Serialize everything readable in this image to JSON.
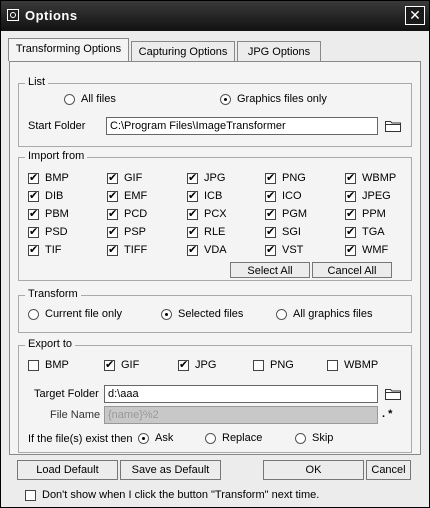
{
  "window": {
    "title": "Options",
    "close_symbol": "✕"
  },
  "tabs": [
    {
      "label": "Transforming Options",
      "active": true
    },
    {
      "label": "Capturing Options",
      "active": false
    },
    {
      "label": "JPG Options",
      "active": false
    }
  ],
  "list": {
    "legend": "List",
    "options": [
      {
        "label": "All files",
        "selected": false
      },
      {
        "label": "Graphics files only",
        "selected": true
      }
    ],
    "start_folder_label": "Start Folder",
    "start_folder_value": "C:\\Program Files\\ImageTransformer"
  },
  "import_from": {
    "legend": "Import from",
    "formats": [
      {
        "label": "BMP",
        "checked": true
      },
      {
        "label": "GIF",
        "checked": true
      },
      {
        "label": "JPG",
        "checked": true
      },
      {
        "label": "PNG",
        "checked": true
      },
      {
        "label": "WBMP",
        "checked": true
      },
      {
        "label": "DIB",
        "checked": true
      },
      {
        "label": "EMF",
        "checked": true
      },
      {
        "label": "ICB",
        "checked": true
      },
      {
        "label": "ICO",
        "checked": true
      },
      {
        "label": "JPEG",
        "checked": true
      },
      {
        "label": "PBM",
        "checked": true
      },
      {
        "label": "PCD",
        "checked": true
      },
      {
        "label": "PCX",
        "checked": true
      },
      {
        "label": "PGM",
        "checked": true
      },
      {
        "label": "PPM",
        "checked": true
      },
      {
        "label": "PSD",
        "checked": true
      },
      {
        "label": "PSP",
        "checked": true
      },
      {
        "label": "RLE",
        "checked": true
      },
      {
        "label": "SGI",
        "checked": true
      },
      {
        "label": "TGA",
        "checked": true
      },
      {
        "label": "TIF",
        "checked": true
      },
      {
        "label": "TIFF",
        "checked": true
      },
      {
        "label": "VDA",
        "checked": true
      },
      {
        "label": "VST",
        "checked": true
      },
      {
        "label": "WMF",
        "checked": true
      }
    ],
    "select_all": "Select All",
    "cancel_all": "Cancel All"
  },
  "transform": {
    "legend": "Transform",
    "options": [
      {
        "label": "Current file only",
        "selected": false
      },
      {
        "label": "Selected files",
        "selected": true
      },
      {
        "label": "All graphics files",
        "selected": false
      }
    ]
  },
  "export_to": {
    "legend": "Export to",
    "formats": [
      {
        "label": "BMP",
        "checked": false
      },
      {
        "label": "GIF",
        "checked": true
      },
      {
        "label": "JPG",
        "checked": true
      },
      {
        "label": "PNG",
        "checked": false
      },
      {
        "label": "WBMP",
        "checked": false
      }
    ],
    "target_folder_label": "Target Folder",
    "target_folder_value": "d:\\aaa",
    "file_name_label": "File Name",
    "file_name_value": "{name}%2",
    "file_ext": ". *",
    "exist_label": "If the file(s) exist then",
    "exist_options": [
      {
        "label": "Ask",
        "selected": true
      },
      {
        "label": "Replace",
        "selected": false
      },
      {
        "label": "Skip",
        "selected": false
      }
    ]
  },
  "buttons": {
    "load_default": "Load Default",
    "save_default": "Save as Default",
    "ok": "OK",
    "cancel": "Cancel"
  },
  "footer": {
    "dont_show": "Don't show when I click the button \"Transform\" next time.",
    "checked": false
  }
}
